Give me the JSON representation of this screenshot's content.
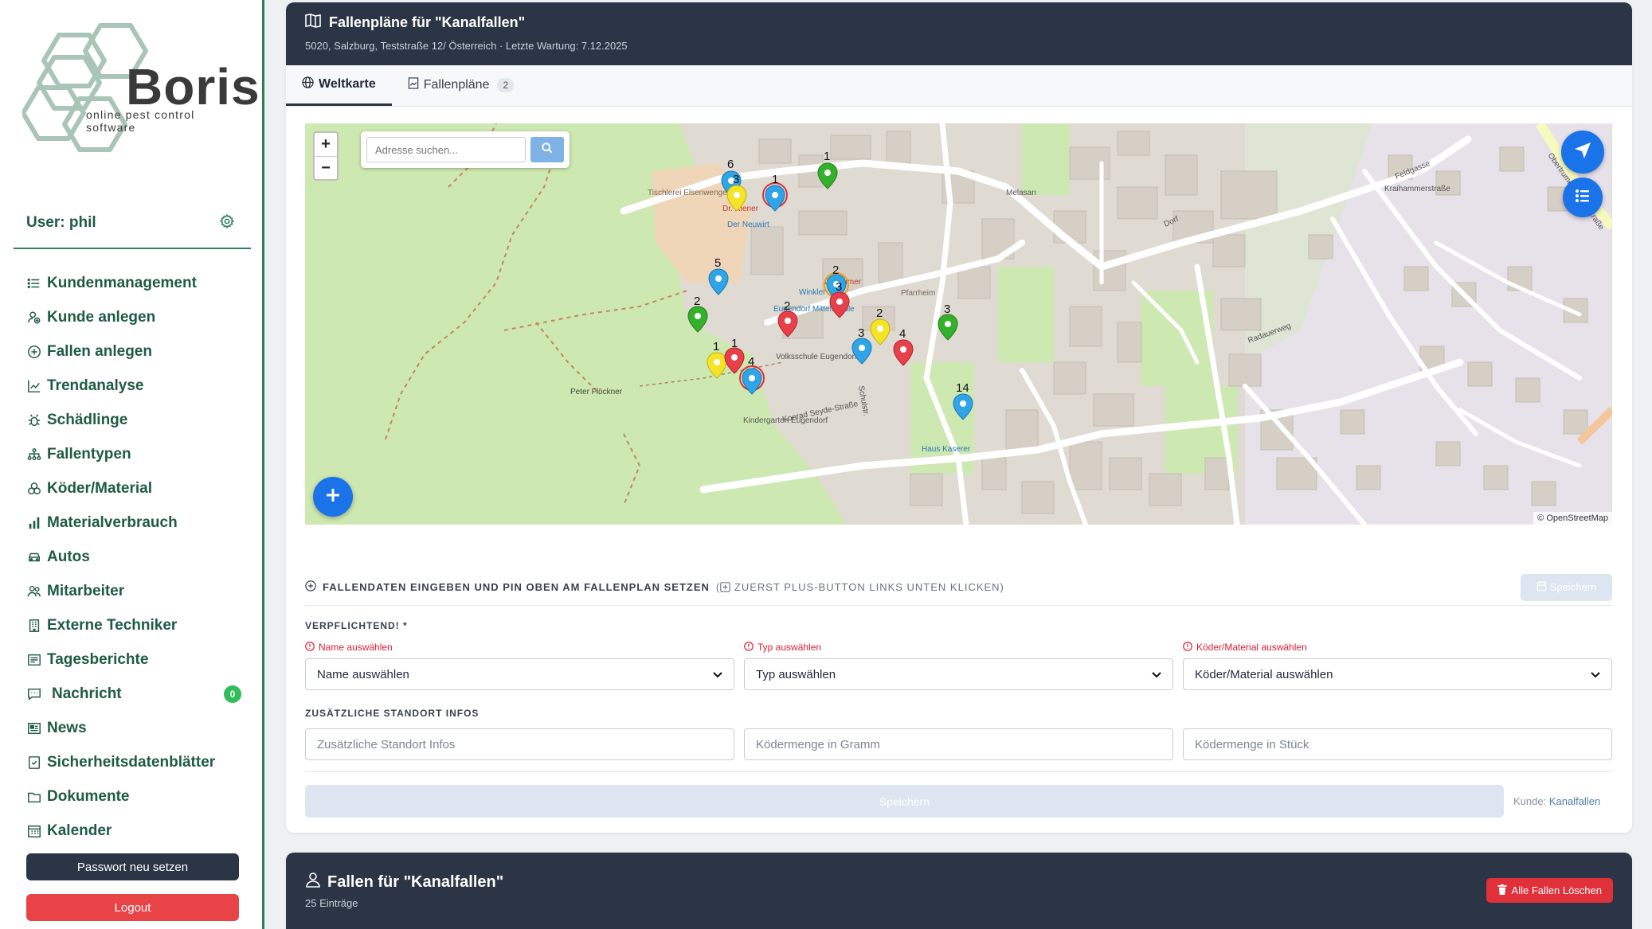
{
  "brand": {
    "name": "Boris",
    "tagline": "online pest control software"
  },
  "user": {
    "label": "User: phil"
  },
  "nav": [
    {
      "label": "Kundenmanagement",
      "icon": "list-icon"
    },
    {
      "label": "Kunde anlegen",
      "icon": "user-add-icon"
    },
    {
      "label": "Fallen anlegen",
      "icon": "plus-circle-icon"
    },
    {
      "label": "Trendanalyse",
      "icon": "trend-chart-icon"
    },
    {
      "label": "Schädlinge",
      "icon": "bug-icon"
    },
    {
      "label": "Fallentypen",
      "icon": "hierarchy-icon"
    },
    {
      "label": "Köder/Material",
      "icon": "ingredients-icon"
    },
    {
      "label": "Materialverbrauch",
      "icon": "bar-chart-icon"
    },
    {
      "label": "Autos",
      "icon": "car-icon"
    },
    {
      "label": "Mitarbeiter",
      "icon": "team-icon"
    },
    {
      "label": "Externe Techniker",
      "icon": "building-icon"
    },
    {
      "label": "Tagesberichte",
      "icon": "report-icon"
    },
    {
      "label": "Nachricht",
      "icon": "message-icon",
      "badge": "0"
    },
    {
      "label": "News",
      "icon": "newspaper-icon"
    },
    {
      "label": "Sicherheitsdatenblätter",
      "icon": "shield-doc-icon"
    },
    {
      "label": "Dokumente",
      "icon": "folder-icon"
    },
    {
      "label": "Kalender",
      "icon": "calendar-icon"
    }
  ],
  "buttons": {
    "password_reset": "Passwort neu setzen",
    "logout": "Logout"
  },
  "header": {
    "title": "Fallenpläne für \"Kanalfallen\"",
    "subtitle": "5020, Salzburg, Teststraße 12/ Österreich · Letzte Wartung: 7.12.2025"
  },
  "tabs": [
    {
      "label": "Weltkarte",
      "active": true
    },
    {
      "label": "Fallenpläne",
      "count": "2"
    }
  ],
  "map": {
    "search_placeholder": "Adresse suchen...",
    "zoom_in": "+",
    "zoom_out": "−",
    "attribution": "© OpenStreetMap",
    "street_labels": [
      "Konrad Seyde-Straße",
      "Radauerweg",
      "Feldgasse",
      "Kraihammerstraße",
      "Dorf",
      "Schulstr.",
      "Obertrumer Landesstraße"
    ],
    "poi_labels": [
      "Dr. Riener",
      "Der Neuwirt",
      "Dr. Laimer",
      "Winkler",
      "Eugendorf Mittelschule",
      "Pfarrheim",
      "Melasan",
      "Kindergarten Eugendorf",
      "Haus Kaserer",
      "Peter Flöckner",
      "Tischlerei Elsenwenger",
      "Volksschule Eugendorf"
    ],
    "pins": [
      {
        "label": "6",
        "color": "#2fa4e7"
      },
      {
        "label": "3",
        "color": "#f5e425"
      },
      {
        "label": "1",
        "color": "#2fa4e7"
      },
      {
        "label": "1",
        "color": "#34b12a"
      },
      {
        "label": "5",
        "color": "#2fa4e7"
      },
      {
        "label": "2",
        "color": "#34b12a"
      },
      {
        "label": "2",
        "color": "#2fa4e7"
      },
      {
        "label": "3",
        "color": "#e8404a"
      },
      {
        "label": "2",
        "color": "#e8404a"
      },
      {
        "label": "2",
        "color": "#f5e425"
      },
      {
        "label": "3",
        "color": "#2fa4e7"
      },
      {
        "label": "4",
        "color": "#e8404a"
      },
      {
        "label": "3",
        "color": "#34b12a"
      },
      {
        "label": "1",
        "color": "#f5e425"
      },
      {
        "label": "1",
        "color": "#e8404a"
      },
      {
        "label": "4",
        "color": "#2fa4e7"
      },
      {
        "label": "14",
        "color": "#2fa4e7"
      }
    ]
  },
  "form": {
    "heading": "FALLENDATEN EINGEBEN UND PIN OBEN AM FALLENPLAN SETZEN",
    "hint": "ZUERST PLUS-BUTTON LINKS UNTEN KLICKEN)",
    "save_small": "Speichern",
    "required_label": "VERPFLICHTEND! *",
    "errors": {
      "name": "Name auswählen",
      "type": "Typ auswählen",
      "bait": "Köder/Material auswählen"
    },
    "selects": {
      "name": "Name auswählen",
      "type": "Typ auswählen",
      "bait": "Köder/Material auswählen"
    },
    "extra_label": "ZUSÄTZLICHE STANDORT INFOS",
    "placeholders": {
      "location": "Zusätzliche Standort Infos",
      "grams": "Ködermenge in Gramm",
      "pieces": "Ködermenge in Stück"
    },
    "save_big": "Speichern",
    "customer_prefix": "Kunde:",
    "customer_name": "Kanalfallen"
  },
  "traps": {
    "title": "Fallen für \"Kanalfallen\"",
    "count": "25 Einträge",
    "delete_all": "Alle Fallen Löschen"
  },
  "colors": {
    "brand_green": "#1f5b43",
    "header_dark": "#2b3545",
    "danger": "#e84347",
    "map_blue": "#1a73e8"
  }
}
